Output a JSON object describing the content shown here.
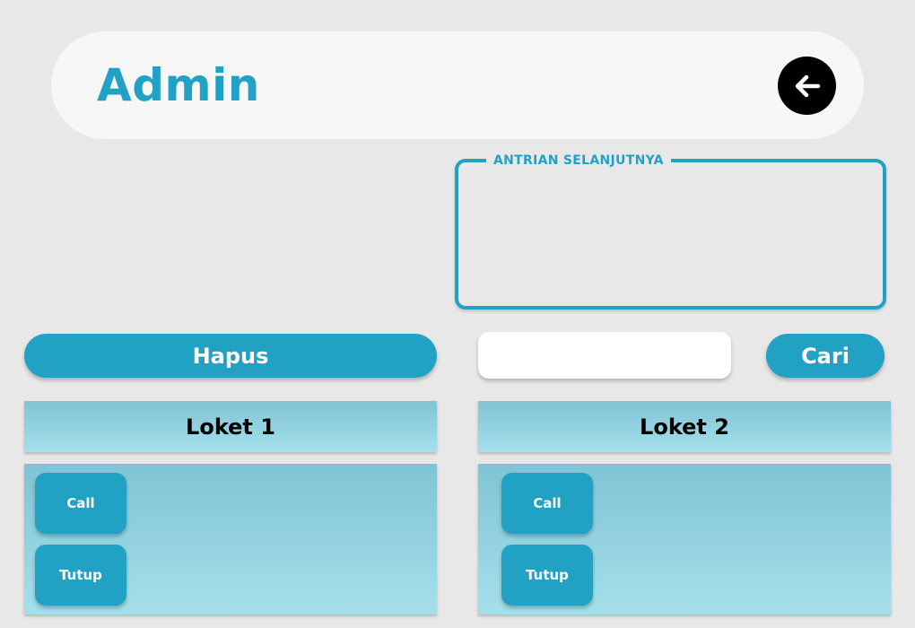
{
  "header": {
    "title": "Admin",
    "back_icon": "arrow-left-icon"
  },
  "next_queue": {
    "legend": "ANTRIAN SELANJUTNYA"
  },
  "actions": {
    "hapus_label": "Hapus",
    "search_value": "",
    "search_placeholder": "",
    "cari_label": "Cari"
  },
  "lokets": [
    {
      "title": "Loket 1",
      "call_label": "Call",
      "tutup_label": "Tutup"
    },
    {
      "title": "Loket 2",
      "call_label": "Call",
      "tutup_label": "Tutup"
    }
  ],
  "colors": {
    "accent": "#21a2c4",
    "background": "#e8e8e8",
    "header_bg": "#f7f7f7",
    "panel_top": "#7fc4d5",
    "panel_bottom": "#a6dfeb"
  }
}
